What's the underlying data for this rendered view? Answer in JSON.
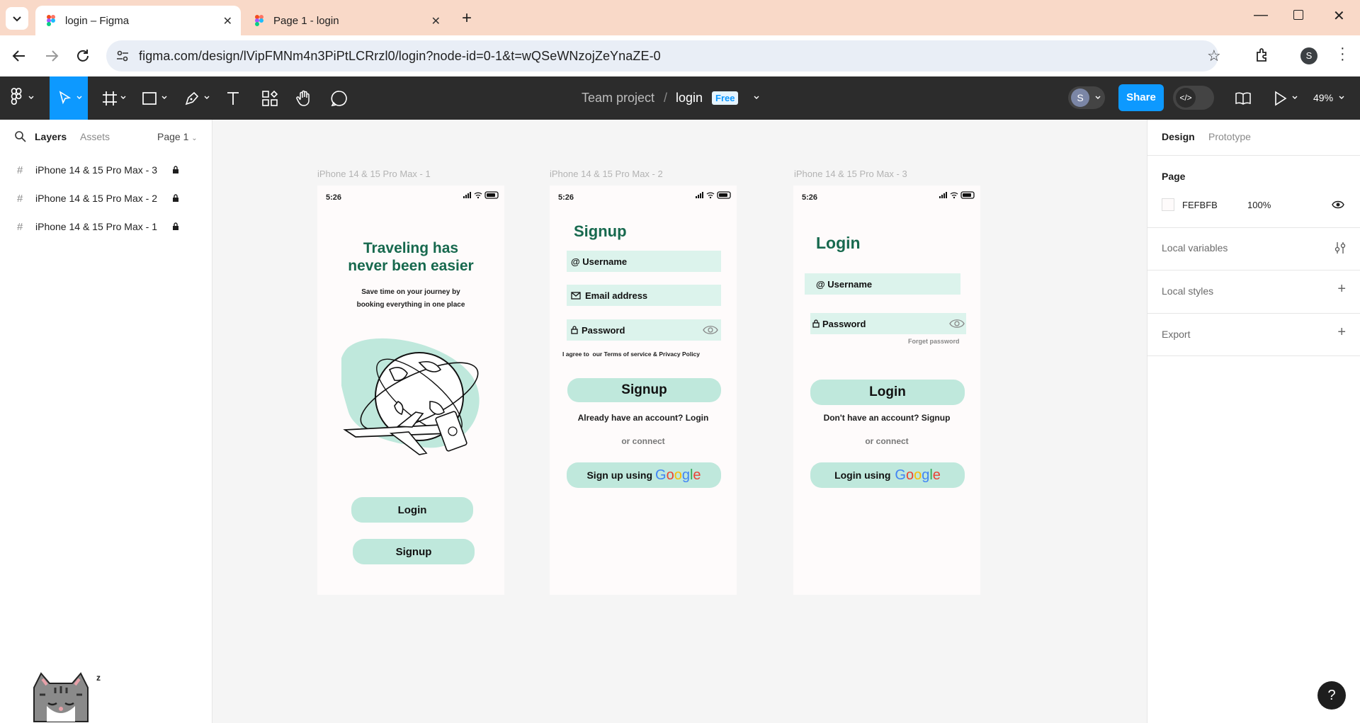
{
  "browser": {
    "tabs": [
      {
        "title": "login – Figma"
      },
      {
        "title": "Page 1 - login"
      }
    ],
    "url": "figma.com/design/lVipFMNm4n3PiPtLCRrzl0/login?node-id=0-1&t=wQSeWNzojZeYnaZE-0",
    "profile_initial": "S"
  },
  "toolbar": {
    "project": "Team project",
    "separator": "/",
    "file": "login",
    "plan_badge": "Free",
    "avatar_initial": "S",
    "share_label": "Share",
    "zoom": "49%"
  },
  "left_panel": {
    "tabs": {
      "layers": "Layers",
      "assets": "Assets"
    },
    "page_selector": "Page 1",
    "layers": [
      {
        "name": "iPhone 14 & 15 Pro Max - 3"
      },
      {
        "name": "iPhone 14 & 15 Pro Max - 2"
      },
      {
        "name": "iPhone 14 & 15 Pro Max - 1"
      }
    ]
  },
  "right_panel": {
    "tabs": {
      "design": "Design",
      "prototype": "Prototype"
    },
    "page_heading": "Page",
    "page_color": "FEFBFB",
    "page_opacity": "100%",
    "sections": {
      "variables": "Local variables",
      "styles": "Local styles",
      "export": "Export"
    }
  },
  "frames": {
    "f1": {
      "label": "iPhone 14 & 15 Pro Max - 1",
      "time": "5:26",
      "title": "Traveling has never been easier",
      "subtitle_line1": "Save time on your journey by",
      "subtitle_line2": "booking everything in one place",
      "login_button": "Login",
      "signup_button": "Signup"
    },
    "f2": {
      "label": "iPhone 14 & 15 Pro Max - 2",
      "time": "5:26",
      "title": "Signup",
      "username": "@ Username",
      "email": "Email address",
      "password": "Password",
      "terms": "I agree to  our Terms of service & Privacy Policy",
      "signup_button": "Signup",
      "have_account": "Already have an account? Login",
      "or_connect": "or connect",
      "google_button": "Sign up using"
    },
    "f3": {
      "label": "iPhone 14 & 15 Pro Max - 3",
      "time": "5:26",
      "title": "Login",
      "username": "@ Username",
      "password": "Password",
      "forget": "Forget password",
      "login_button": "Login",
      "no_account": "Don't have an account? Signup",
      "or_connect": "or connect",
      "google_button": "Login using"
    }
  },
  "google_word": {
    "G": "G",
    "o1": "o",
    "o2": "o",
    "g": "g",
    "l": "l",
    "e": "e"
  },
  "help": "?",
  "colors": {
    "figma_toolbar": "#2c2c2c",
    "share_button": "#0d99ff",
    "brand_green": "#17694e",
    "field_bg": "#dcf3ec",
    "button_bg": "#bfe8dc",
    "tab_strip": "#f9d9c8"
  }
}
